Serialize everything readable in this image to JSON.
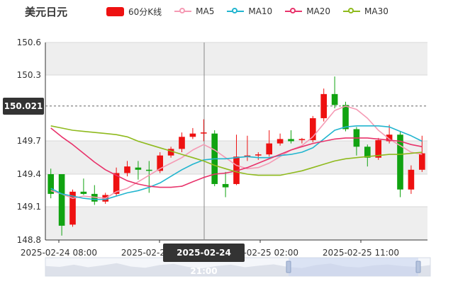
{
  "title": "美元日元",
  "legend": [
    {
      "label": "60分K线",
      "color": "#ee1111",
      "kind": "box"
    },
    {
      "label": "MA5",
      "color": "#f59ab4",
      "kind": "line"
    },
    {
      "label": "MA10",
      "color": "#22b5cf",
      "kind": "line"
    },
    {
      "label": "MA20",
      "color": "#e8336b",
      "kind": "line"
    },
    {
      "label": "MA30",
      "color": "#8fba1d",
      "kind": "line"
    }
  ],
  "crosshair": {
    "price_label": "150.021",
    "time_label": "2025-02-24 21:00"
  },
  "colors": {
    "up": "#ee1111",
    "down": "#11a311",
    "band": "#eeeeee",
    "axis": "#333333"
  },
  "chart_data": {
    "type": "candlestick",
    "y_ticks": [
      "150.6",
      "150.3",
      "149.7",
      "149.4",
      "149.1",
      "148.8"
    ],
    "x_ticks": [
      "2025-02-24 08:00",
      "2025-02-24 21:00",
      "2025-02-25 02:00",
      "2025-02-25 11:00"
    ],
    "ylim": [
      148.8,
      150.6
    ],
    "candles": [
      {
        "o": 149.4,
        "c": 149.22,
        "h": 149.45,
        "l": 149.18
      },
      {
        "o": 149.4,
        "c": 148.93,
        "h": 149.4,
        "l": 148.84
      },
      {
        "o": 148.94,
        "c": 149.24,
        "h": 149.26,
        "l": 148.92
      },
      {
        "o": 149.24,
        "c": 149.22,
        "h": 149.36,
        "l": 149.21
      },
      {
        "o": 149.22,
        "c": 149.15,
        "h": 149.3,
        "l": 149.12
      },
      {
        "o": 149.15,
        "c": 149.21,
        "h": 149.23,
        "l": 149.13
      },
      {
        "o": 149.22,
        "c": 149.41,
        "h": 149.46,
        "l": 149.2
      },
      {
        "o": 149.41,
        "c": 149.47,
        "h": 149.52,
        "l": 149.38
      },
      {
        "o": 149.46,
        "c": 149.44,
        "h": 149.52,
        "l": 149.35
      },
      {
        "o": 149.44,
        "c": 149.43,
        "h": 149.52,
        "l": 149.23
      },
      {
        "o": 149.43,
        "c": 149.57,
        "h": 149.6,
        "l": 149.41
      },
      {
        "o": 149.57,
        "c": 149.63,
        "h": 149.65,
        "l": 149.55
      },
      {
        "o": 149.63,
        "c": 149.74,
        "h": 149.78,
        "l": 149.6
      },
      {
        "o": 149.74,
        "c": 149.77,
        "h": 149.82,
        "l": 149.72
      },
      {
        "o": 149.77,
        "c": 149.78,
        "h": 149.9,
        "l": 149.7
      },
      {
        "o": 149.77,
        "c": 149.31,
        "h": 149.8,
        "l": 149.29
      },
      {
        "o": 149.31,
        "c": 149.28,
        "h": 149.42,
        "l": 149.19
      },
      {
        "o": 149.31,
        "c": 149.56,
        "h": 149.76,
        "l": 149.3
      },
      {
        "o": 149.56,
        "c": 149.57,
        "h": 149.75,
        "l": 149.52
      },
      {
        "o": 149.57,
        "c": 149.58,
        "h": 149.6,
        "l": 149.53
      },
      {
        "o": 149.58,
        "c": 149.68,
        "h": 149.8,
        "l": 149.56
      },
      {
        "o": 149.68,
        "c": 149.72,
        "h": 149.77,
        "l": 149.66
      },
      {
        "o": 149.72,
        "c": 149.7,
        "h": 149.8,
        "l": 149.68
      },
      {
        "o": 149.71,
        "c": 149.72,
        "h": 149.73,
        "l": 149.68
      },
      {
        "o": 149.71,
        "c": 149.91,
        "h": 149.93,
        "l": 149.69
      },
      {
        "o": 149.91,
        "c": 150.13,
        "h": 150.18,
        "l": 149.88
      },
      {
        "o": 150.13,
        "c": 150.03,
        "h": 150.29,
        "l": 150.0
      },
      {
        "o": 150.03,
        "c": 149.81,
        "h": 150.06,
        "l": 149.79
      },
      {
        "o": 149.81,
        "c": 149.65,
        "h": 149.83,
        "l": 149.57
      },
      {
        "o": 149.65,
        "c": 149.55,
        "h": 149.67,
        "l": 149.47
      },
      {
        "o": 149.55,
        "c": 149.71,
        "h": 149.73,
        "l": 149.53
      },
      {
        "o": 149.7,
        "c": 149.76,
        "h": 149.85,
        "l": 149.68
      },
      {
        "o": 149.76,
        "c": 149.26,
        "h": 149.79,
        "l": 149.19
      },
      {
        "o": 149.26,
        "c": 149.44,
        "h": 149.48,
        "l": 149.22
      },
      {
        "o": 149.44,
        "c": 149.59,
        "h": 149.75,
        "l": 149.42
      }
    ],
    "series": [
      {
        "name": "MA5",
        "values": [
          149.25,
          149.22,
          149.18,
          149.2,
          149.19,
          149.18,
          149.24,
          149.27,
          149.33,
          149.39,
          149.45,
          149.5,
          149.55,
          149.62,
          149.67,
          149.62,
          149.55,
          149.48,
          149.45,
          149.46,
          149.5,
          149.56,
          149.62,
          149.66,
          149.74,
          149.86,
          149.98,
          150.02,
          149.99,
          149.91,
          149.8,
          149.72,
          149.66,
          149.6,
          149.58
        ]
      },
      {
        "name": "MA10",
        "values": [
          149.27,
          149.22,
          149.2,
          149.18,
          149.17,
          149.17,
          149.2,
          149.23,
          149.25,
          149.28,
          149.32,
          149.38,
          149.44,
          149.49,
          149.53,
          149.54,
          149.54,
          149.55,
          149.56,
          149.55,
          149.55,
          149.57,
          149.58,
          149.6,
          149.64,
          149.72,
          149.8,
          149.83,
          149.84,
          149.84,
          149.84,
          149.83,
          149.79,
          149.75,
          149.7
        ]
      },
      {
        "name": "MA20",
        "values": [
          149.82,
          149.74,
          149.67,
          149.59,
          149.51,
          149.44,
          149.39,
          149.34,
          149.31,
          149.29,
          149.28,
          149.28,
          149.29,
          149.33,
          149.37,
          149.4,
          149.41,
          149.43,
          149.46,
          149.5,
          149.54,
          149.58,
          149.62,
          149.65,
          149.68,
          149.7,
          149.72,
          149.73,
          149.73,
          149.73,
          149.72,
          149.71,
          149.7,
          149.67,
          149.65
        ]
      },
      {
        "name": "MA30",
        "values": [
          149.84,
          149.82,
          149.8,
          149.79,
          149.78,
          149.77,
          149.76,
          149.74,
          149.7,
          149.67,
          149.64,
          149.61,
          149.58,
          149.55,
          149.52,
          149.48,
          149.45,
          149.42,
          149.4,
          149.39,
          149.39,
          149.39,
          149.41,
          149.43,
          149.46,
          149.49,
          149.52,
          149.54,
          149.55,
          149.56,
          149.57,
          149.58,
          149.58,
          149.59,
          149.6
        ]
      }
    ]
  }
}
